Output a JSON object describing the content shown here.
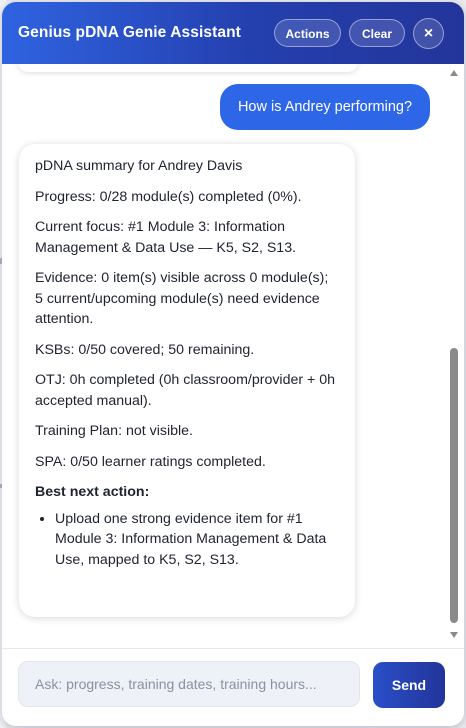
{
  "header": {
    "title": "Genius pDNA Genie Assistant",
    "actions_label": "Actions",
    "clear_label": "Clear",
    "close_label": "×"
  },
  "chat": {
    "user_message": "How is Andrey performing?",
    "bot": {
      "title": "pDNA summary for Andrey Davis",
      "progress": "Progress: 0/28 module(s) completed (0%).",
      "current_focus": "Current focus: #1 Module 3: Information Management & Data Use — K5, S2, S13.",
      "evidence": "Evidence: 0 item(s) visible across 0 module(s); 5 current/upcoming module(s) need evidence attention.",
      "ksbs": "KSBs: 0/50 covered; 50 remaining.",
      "otj": "OTJ: 0h completed (0h classroom/provider + 0h accepted manual).",
      "training_plan": "Training Plan: not visible.",
      "spa": "SPA: 0/50 learner ratings completed.",
      "next_action_heading": "Best next action:",
      "next_actions": [
        "Upload one strong evidence item for #1 Module 3: Information Management & Data Use, mapped to K5, S2, S13."
      ]
    }
  },
  "composer": {
    "placeholder": "Ask: progress, training dates, training hours...",
    "send_label": "Send"
  },
  "colors": {
    "header_start": "#2f63e0",
    "header_end": "#23359a",
    "user_bubble": "#2d66e6",
    "send_button": "#22349a"
  }
}
